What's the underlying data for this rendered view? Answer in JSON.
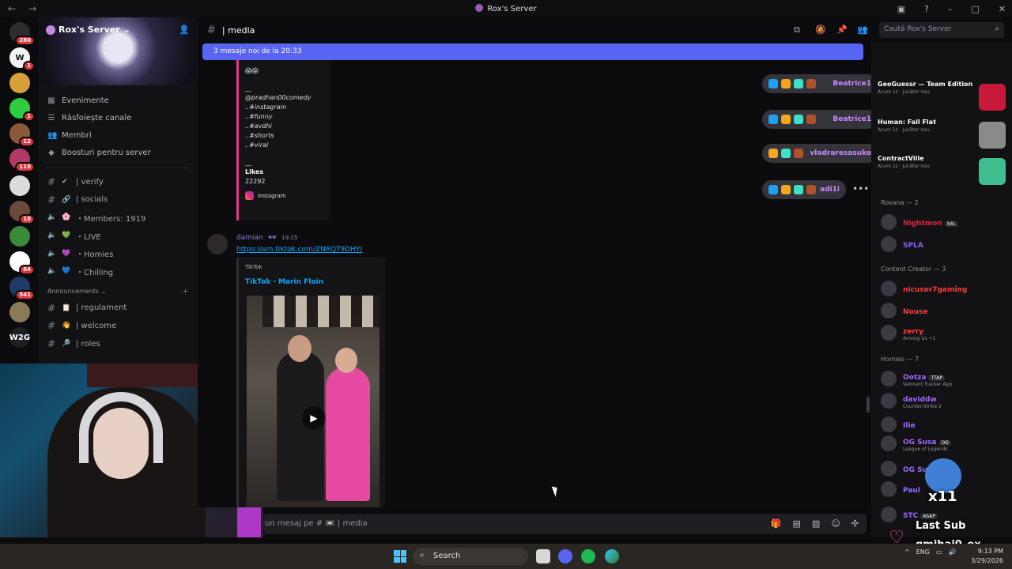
{
  "titlebar": {
    "title": "Rox's Server"
  },
  "rail": {
    "servers": [
      {
        "label": "",
        "color": "#2b2d31",
        "badge": "280"
      },
      {
        "label": "W",
        "color": "#f2f3f5",
        "badge": "1"
      },
      {
        "label": "",
        "color": "#d6a13a",
        "badge": ""
      },
      {
        "label": "",
        "color": "#2ecc40",
        "badge": "1"
      },
      {
        "label": "",
        "color": "#8a5a3a",
        "badge": "12"
      },
      {
        "label": "",
        "color": "#b23a6b",
        "badge": "119"
      },
      {
        "label": "",
        "color": "#dcdcdc",
        "badge": ""
      },
      {
        "label": "",
        "color": "#6a4a3a",
        "badge": "18"
      },
      {
        "label": "",
        "color": "#3a8a3a",
        "badge": ""
      },
      {
        "label": "",
        "color": "#ffffff",
        "badge": "64"
      },
      {
        "label": "",
        "color": "#1f3a6a",
        "badge": "541"
      },
      {
        "label": "",
        "color": "#8a7a5a",
        "badge": ""
      },
      {
        "label": "W2G",
        "color": "#1e1f22",
        "badge": ""
      }
    ]
  },
  "sidebar": {
    "server_name": "Rox's Server",
    "menu": [
      "Evenimente",
      "Răsfoiește canale",
      "Membri",
      "Boosturi pentru server"
    ],
    "channels": [
      {
        "emoji": "✔",
        "name": "| verify"
      },
      {
        "emoji": "🔗",
        "name": "| socials"
      },
      {
        "emoji": "🌸",
        "name": "・Members: 1919"
      },
      {
        "emoji": "💚",
        "name": "・LIVE"
      },
      {
        "emoji": "💜",
        "name": "・Homies"
      },
      {
        "emoji": "💙",
        "name": "・Chilling"
      }
    ],
    "category": "Announcements",
    "ann_channels": [
      {
        "emoji": "📋",
        "name": "| regulament"
      },
      {
        "emoji": "👋",
        "name": "| welcome"
      },
      {
        "emoji": "🔎",
        "name": "| roles"
      }
    ]
  },
  "header": {
    "channel": "| media",
    "search_placeholder": "Caută Rox's Server"
  },
  "newbar": "3 mesaje noi de la 20:33",
  "embed1": {
    "lines": [
      "@pradhan00comedy",
      "..#instagram",
      "..#funny",
      "..#avdhi",
      "..#shorts",
      "..#viral"
    ],
    "likes_label": "Likes",
    "likes_value": "22292",
    "provider": "Instagram"
  },
  "message": {
    "author": "damian",
    "time": "19:15",
    "link": "https://vm.tiktok.com/ZNRQT9DHY/",
    "embed_provider": "TikTok",
    "embed_title": "TikTok · Marin Floin"
  },
  "overlay_pills": [
    {
      "name": "Beatrice1"
    },
    {
      "name": "Beatrice1"
    },
    {
      "name": "vladraresasuke"
    },
    {
      "name": "adi1i"
    }
  ],
  "composer_placeholder": "un mesaj pe # 📼 | media",
  "members": {
    "activities": [
      {
        "game": "GeoGuessr — Team Edition",
        "sub": "Acum 1z · Jucător nou",
        "color": "#c9193a"
      },
      {
        "game": "Human: Fall Flat",
        "sub": "Acum 1z · Jucător nou",
        "color": "#8a8a8a"
      },
      {
        "game": "ContractVille",
        "sub": "Acum 1z · Jucător nou",
        "color": "#3fbf8f"
      }
    ],
    "groups": [
      {
        "title": "Roxana — 2",
        "members": [
          {
            "name": "Nightmon",
            "color": "#e02040",
            "status": "",
            "tag": "S4L"
          },
          {
            "name": "SPLA",
            "color": "#8b5cf6",
            "status": "",
            "tag": ""
          }
        ]
      },
      {
        "title": "Content Creator — 3",
        "members": [
          {
            "name": "nicusor7gaming",
            "color": "#ff3b3b",
            "status": "",
            "tag": ""
          },
          {
            "name": "Nouse",
            "color": "#ff3b3b",
            "status": "",
            "tag": ""
          },
          {
            "name": "zerry",
            "color": "#ff3b3b",
            "status": "Among Us +1",
            "tag": ""
          }
        ]
      },
      {
        "title": "Homies — 7",
        "members": [
          {
            "name": "Ootza",
            "color": "#9b6bff",
            "status": "Valorant Tracker App",
            "tag": "TTAP"
          },
          {
            "name": "daviddw",
            "color": "#9b6bff",
            "status": "Counter-Strike 2",
            "tag": ""
          },
          {
            "name": "Ilie",
            "color": "#9b6bff",
            "status": "",
            "tag": ""
          },
          {
            "name": "OG Susa",
            "color": "#9b6bff",
            "status": "League of Legends",
            "tag": "OG"
          },
          {
            "name": "OG Susa",
            "color": "#9b6bff",
            "status": "",
            "tag": "OG"
          },
          {
            "name": "Paul",
            "color": "#9b6bff",
            "status": "",
            "tag": ""
          },
          {
            "name": "STC",
            "color": "#9b6bff",
            "status": "",
            "tag": "ASAP"
          }
        ]
      }
    ]
  },
  "sub_alert": {
    "count": "x11",
    "label": "Last Sub",
    "username": "qmihai0_ox"
  },
  "taskbar": {
    "search": "Search",
    "lang": "ENG",
    "time": "9:13 PM",
    "date": "3/29/2026"
  }
}
